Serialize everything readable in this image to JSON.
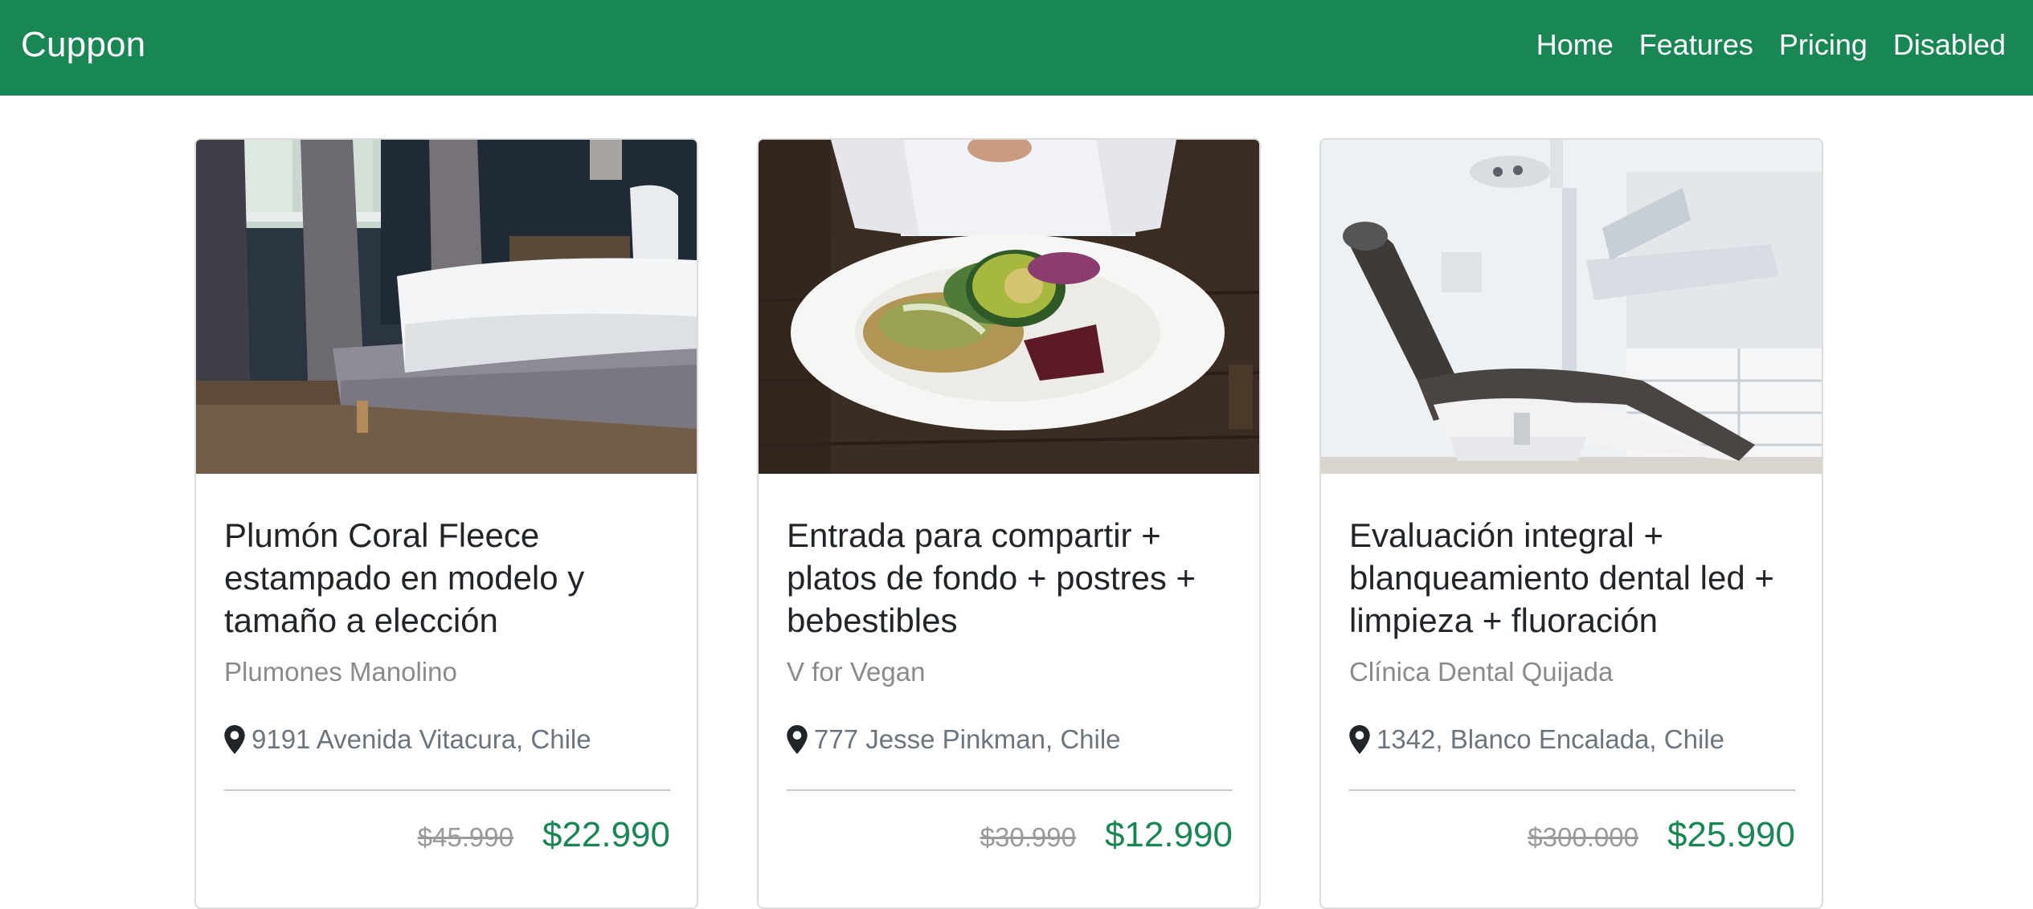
{
  "navbar": {
    "brand": "Cuppon",
    "links": [
      "Home",
      "Features",
      "Pricing",
      "Disabled"
    ],
    "background": "#198754"
  },
  "colors": {
    "accent": "#198754",
    "price_new": "#198754",
    "price_old": "#9a9a9a"
  },
  "cards": [
    {
      "image": "bedroom-photo",
      "title": "Plumón Coral Fleece estampado en modelo y tamaño a elección",
      "store": "Plumones Manolino",
      "address": "9191 Avenida Vitacura, Chile",
      "old_price": "$45.990",
      "new_price": "$22.990"
    },
    {
      "image": "vegan-food-plate-photo",
      "title": "Entrada para compartir + platos de fondo + postres + bebestibles",
      "store": "V for Vegan",
      "address": "777 Jesse Pinkman, Chile",
      "old_price": "$30.990",
      "new_price": "$12.990"
    },
    {
      "image": "dental-chair-photo",
      "title": "Evaluación integral + blanqueamiento dental led + limpieza + fluoración",
      "store": "Clínica Dental Quijada",
      "address": "1342, Blanco Encalada, Chile",
      "old_price": "$300.000",
      "new_price": "$25.990"
    }
  ]
}
